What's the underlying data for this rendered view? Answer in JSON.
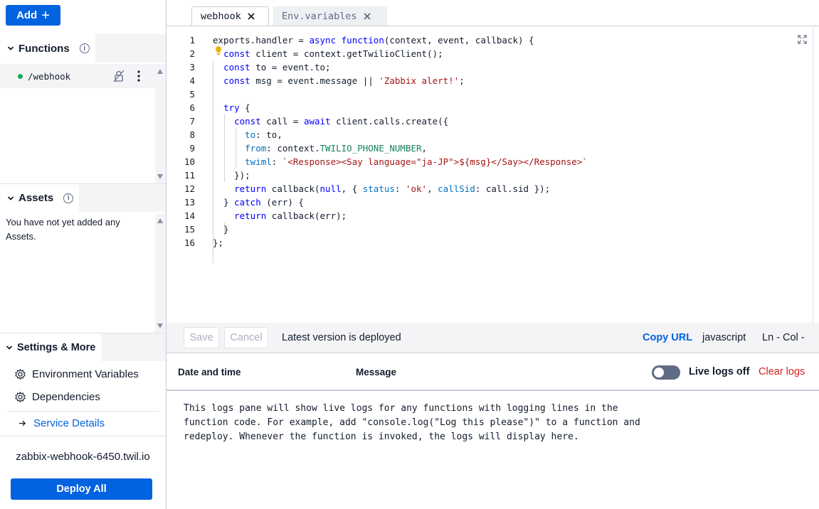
{
  "sidebar": {
    "add_label": "Add",
    "functions": {
      "title": "Functions",
      "items": [
        {
          "path": "/webhook",
          "status_color": "#14b053"
        }
      ]
    },
    "assets": {
      "title": "Assets",
      "empty_text": "You have not yet added any Assets."
    },
    "settings": {
      "title": "Settings & More",
      "links": [
        "Environment Variables",
        "Dependencies"
      ],
      "service_details": "Service Details"
    },
    "domain": "zabbix-webhook-6450.twil.io",
    "deploy_label": "Deploy All"
  },
  "tabs": [
    {
      "label": "webhook",
      "active": true
    },
    {
      "label": "Env.variables",
      "active": false
    }
  ],
  "editor": {
    "line_numbers": [
      "1",
      "2",
      "3",
      "4",
      "5",
      "6",
      "7",
      "8",
      "9",
      "10",
      "11",
      "12",
      "13",
      "14",
      "15",
      "16"
    ],
    "lines": [
      "exports.handler = async function(context, event, callback) {",
      "  const client = context.getTwilioClient();",
      "  const to = event.to;",
      "  const msg = event.message || 'Zabbix alert!';",
      "",
      "  try {",
      "    const call = await client.calls.create({",
      "      to: to,",
      "      from: context.TWILIO_PHONE_NUMBER,",
      "      twiml: `<Response><Say language=\"ja-JP\">${msg}</Say></Response>`",
      "    });",
      "    return callback(null, { status: 'ok', callSid: call.sid });",
      "  } catch (err) {",
      "    return callback(err);",
      "  }",
      "};"
    ]
  },
  "toolbar": {
    "save_label": "Save",
    "cancel_label": "Cancel",
    "status": "Latest version is deployed",
    "copy_url": "Copy URL",
    "language": "javascript",
    "position": "Ln -  Col -"
  },
  "logs": {
    "col_date": "Date and time",
    "col_message": "Message",
    "live_label": "Live logs off",
    "clear_label": "Clear logs",
    "empty_text": "This logs pane will show live logs for any functions with logging lines in the function code. For example, add \"console.log(\"Log this please\")\" to a function and redeploy. Whenever the function is invoked, the logs will display here."
  },
  "colors": {
    "primary": "#0263e0",
    "danger": "#d61f1f",
    "success": "#14b053"
  },
  "icons": [
    "plus-icon",
    "chevron-down-icon",
    "info-icon",
    "lock-icon",
    "kebab-menu-icon",
    "gear-icon",
    "arrow-right-icon",
    "close-icon",
    "lightbulb-icon",
    "expand-icon"
  ]
}
